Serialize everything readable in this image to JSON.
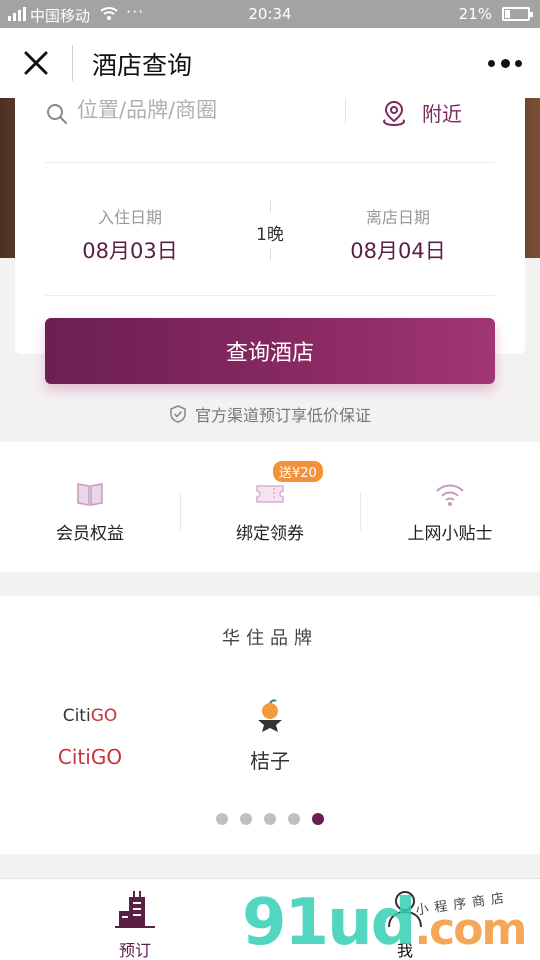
{
  "status_bar": {
    "carrier": "中国移动",
    "dots": "···",
    "time": "20:34",
    "battery": "21%"
  },
  "header": {
    "title": "酒店查询"
  },
  "search": {
    "placeholder": "位置/品牌/商圈",
    "nearby_label": "附近"
  },
  "dates": {
    "checkin_label": "入住日期",
    "checkin_value": "08月03日",
    "nights": "1晚",
    "checkout_label": "离店日期",
    "checkout_value": "08月04日"
  },
  "search_button": "查询酒店",
  "guarantee_text": "官方渠道预订享低价保证",
  "features": [
    {
      "label": "会员权益",
      "icon": "book-icon"
    },
    {
      "label": "绑定领券",
      "icon": "ticket-icon",
      "badge": "送¥20"
    },
    {
      "label": "上网小贴士",
      "icon": "wifi-icon"
    }
  ],
  "brands": {
    "title": "华住品牌",
    "items": [
      {
        "logo_text": "CitiGO",
        "name": "CitiGO",
        "color": "#c8323b"
      },
      {
        "name": "桔子",
        "icon": "orange-logo-icon"
      }
    ],
    "page_count": 5,
    "active_page": 5
  },
  "tabbar": [
    {
      "label": "预订",
      "icon": "hotel-building-icon",
      "active": true
    },
    {
      "label": "我",
      "icon": "person-icon",
      "active": false
    }
  ],
  "watermark": {
    "main": "91ud",
    "suffix": ".com",
    "sub": "小程序商店"
  },
  "colors": {
    "accent": "#6b1f50",
    "badge": "#f3923a",
    "brand_red": "#c8323b"
  }
}
